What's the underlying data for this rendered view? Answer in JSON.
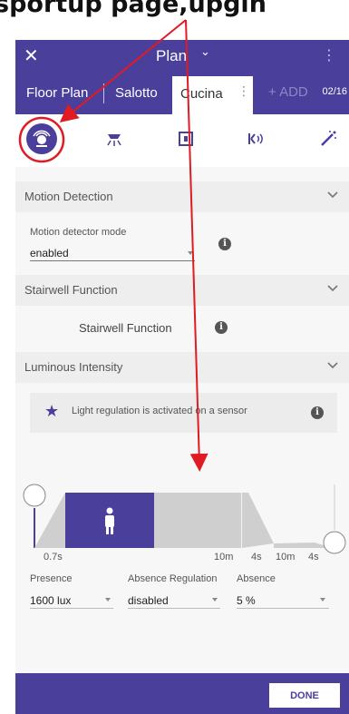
{
  "caption": "sportup page,upgin",
  "topbar": {
    "close_glyph": "✕",
    "title": "Plan",
    "title_chevron": "⌄",
    "menu_glyph": "⋮"
  },
  "tabs": {
    "items": [
      "Floor Plan",
      "Salotto",
      "Cucina"
    ],
    "active_menu_glyph": "⋮",
    "add_label": "+ ADD",
    "counter": "02/16"
  },
  "icon_bar": {
    "icons": [
      "motion-sensor-icon",
      "ceiling-light-icon",
      "square-switch-icon",
      "signal-waves-icon",
      "magic-wand-icon"
    ],
    "active_index": 0
  },
  "sections": {
    "motion": {
      "title": "Motion Detection",
      "field_label": "Motion detector mode",
      "field_value": "enabled"
    },
    "stairwell": {
      "title": "Stairwell Function",
      "toggle_label": "Stairwell Function",
      "toggle_on": false
    },
    "luminous": {
      "title": "Luminous Intensity",
      "info_text": "Light regulation is activated on a sensor"
    }
  },
  "timeline": {
    "times": [
      "0.7s",
      "10m",
      "4s",
      "10m",
      "4s"
    ],
    "presence_active": true
  },
  "bottom_fields": [
    {
      "label": "Presence",
      "value": "1600 lux"
    },
    {
      "label": "Absence Regulation",
      "value": "disabled"
    },
    {
      "label": "Absence",
      "value": "5 %"
    }
  ],
  "footer": {
    "done_label": "DONE"
  },
  "colors": {
    "primary": "#4a3f9b",
    "annotation_red": "#e01b24",
    "bg": "#f7f7f7"
  }
}
